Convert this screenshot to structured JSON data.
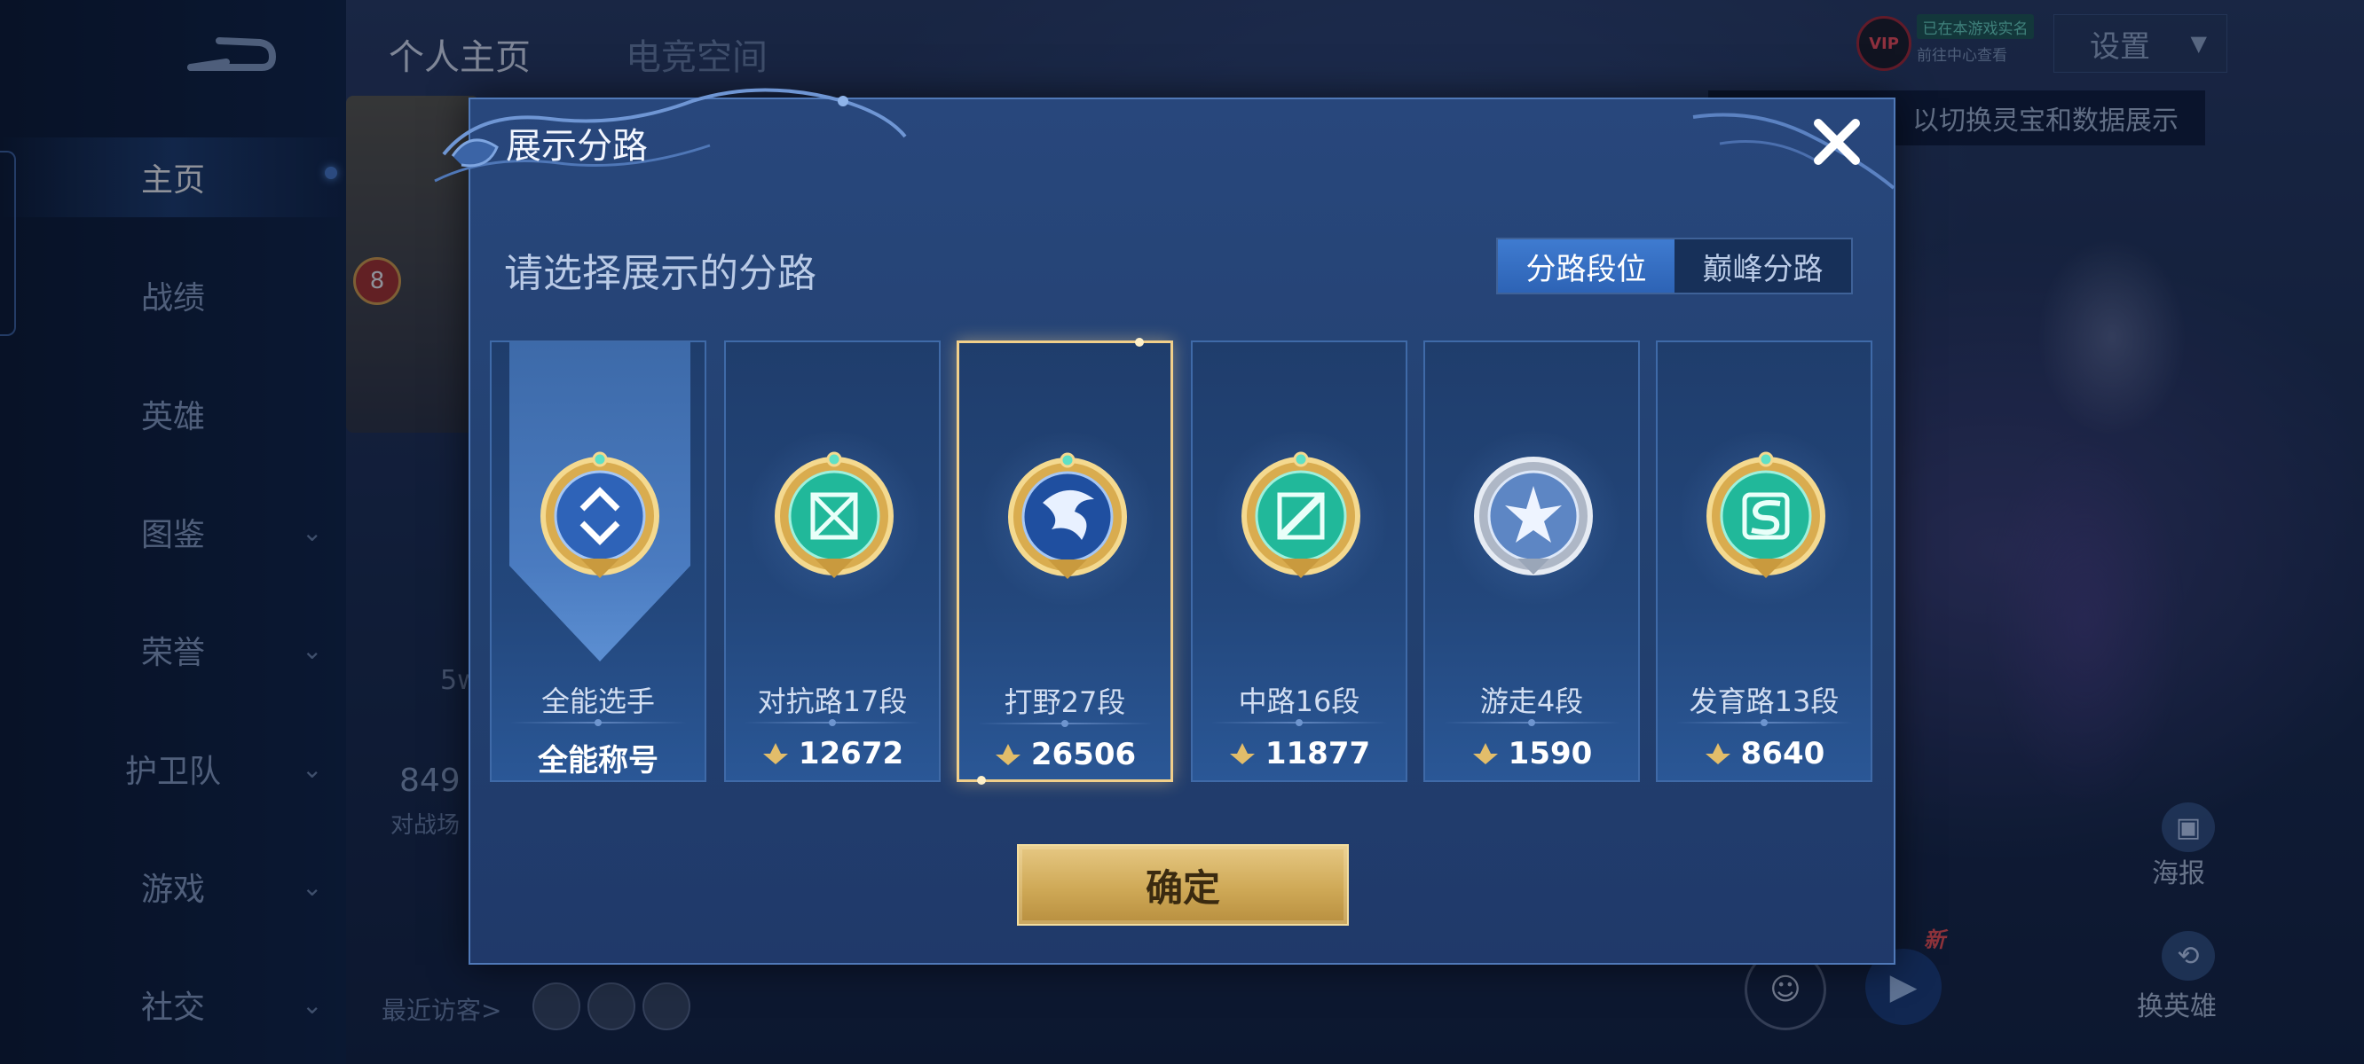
{
  "topbar": {
    "tabs": [
      {
        "label": "个人主页"
      },
      {
        "label": "电竞空间"
      }
    ],
    "vip_label": "VIP",
    "qq_chip": "已在本游戏实名",
    "center_link": "前往中心查看",
    "settings_label": "设置",
    "hint": "以切换灵宝和数据展示"
  },
  "sidebar": {
    "items": [
      {
        "label": "主页"
      },
      {
        "label": "战绩"
      },
      {
        "label": "英雄"
      },
      {
        "label": "图鉴"
      },
      {
        "label": "荣誉"
      },
      {
        "label": "护卫队"
      },
      {
        "label": "游戏"
      },
      {
        "label": "社交"
      }
    ]
  },
  "profile": {
    "level": "8",
    "fragment_5w": "5w",
    "fragment_849": "849",
    "fragment_duizhan": "对战场",
    "recent_visitors": "最近访客>"
  },
  "right_controls": {
    "poster": "海报",
    "swap_hero": "换英雄",
    "new_tag": "新"
  },
  "modal": {
    "title": "展示分路",
    "subtitle": "请选择展示的分路",
    "toggle": [
      {
        "label": "分路段位",
        "active": true
      },
      {
        "label": "巅峰分路",
        "active": false
      }
    ],
    "cards": [
      {
        "name": "全能选手",
        "score": "全能称号",
        "icon": "all-round-emblem-icon",
        "has_points": false
      },
      {
        "name": "对抗路17段",
        "score": "12672",
        "icon": "clash-lane-emblem-icon",
        "has_points": true
      },
      {
        "name": "打野27段",
        "score": "26506",
        "icon": "jungle-emblem-icon",
        "has_points": true,
        "selected": true
      },
      {
        "name": "中路16段",
        "score": "11877",
        "icon": "mid-lane-emblem-icon",
        "has_points": true
      },
      {
        "name": "游走4段",
        "score": "1590",
        "icon": "roam-emblem-icon",
        "has_points": true
      },
      {
        "name": "发育路13段",
        "score": "8640",
        "icon": "farm-lane-emblem-icon",
        "has_points": true
      }
    ],
    "confirm_label": "确定"
  },
  "colors": {
    "accent_blue": "#3f7bd0",
    "gold": "#cfa957",
    "selected_border": "#f1cf8a"
  }
}
